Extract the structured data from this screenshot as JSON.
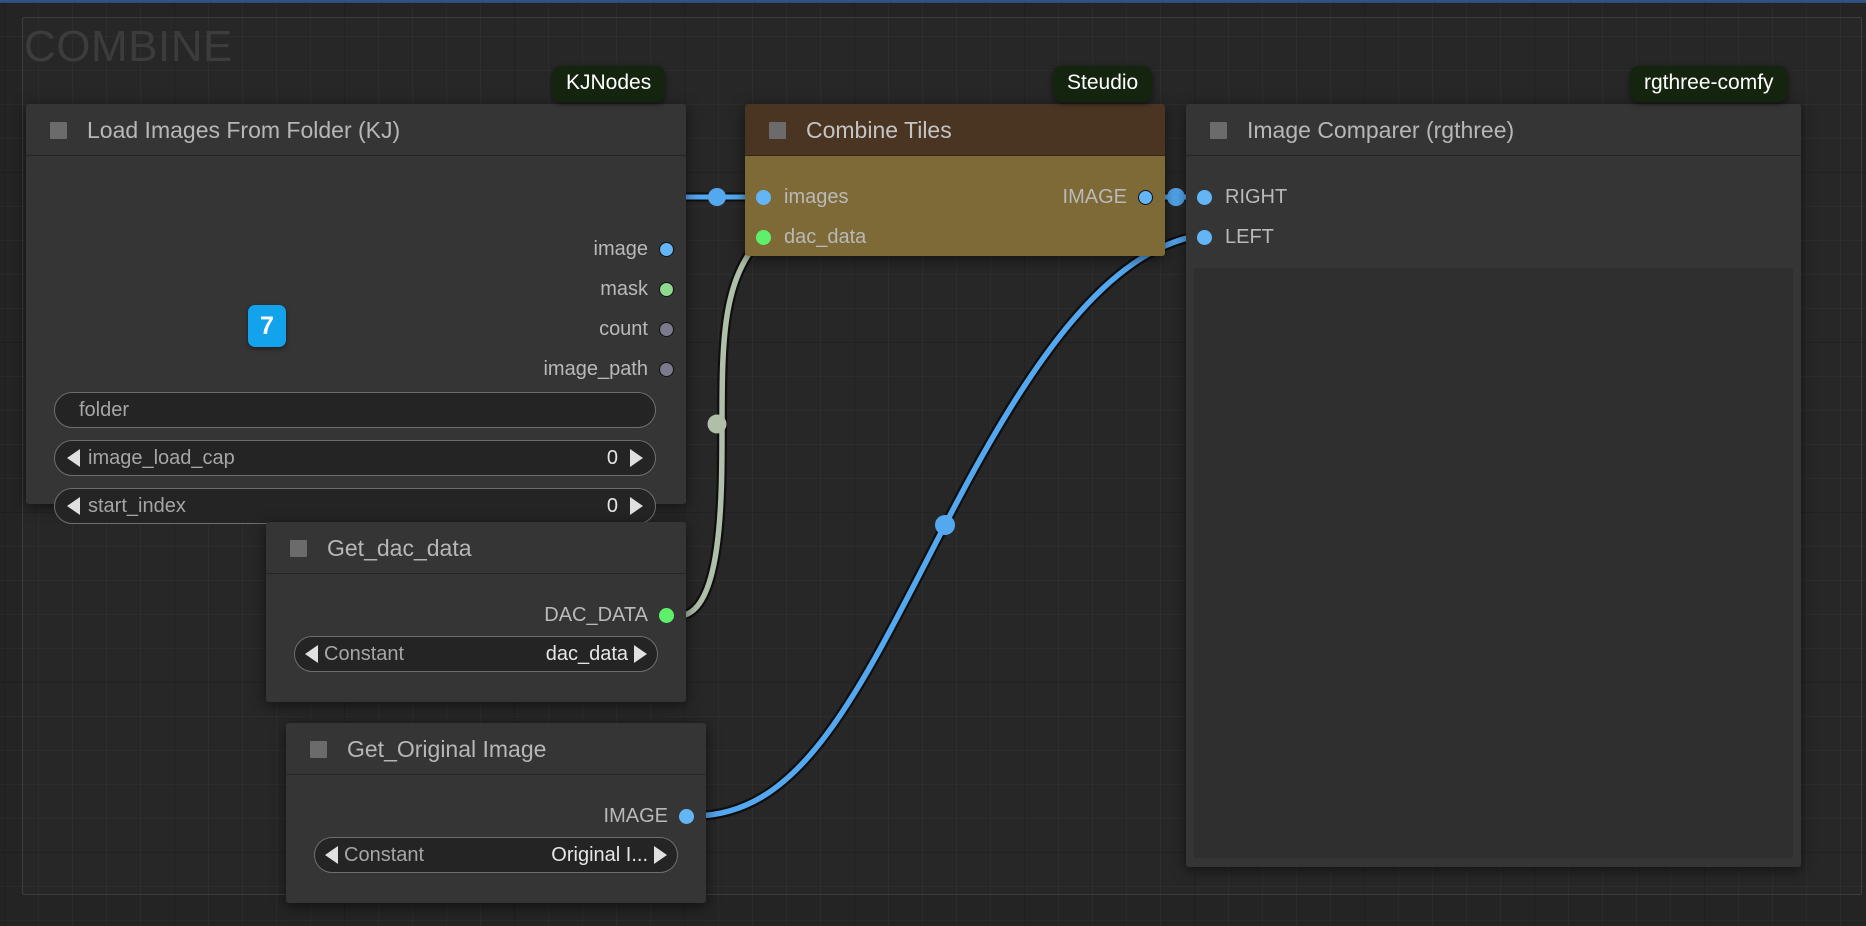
{
  "canvas": {
    "background": "#242424",
    "grid_minor": "#2b2b2b",
    "grid_major": "#1d1d1d"
  },
  "group": {
    "title": "COMBINE",
    "title_color": "#3c3c3c"
  },
  "colors": {
    "slot_image": "#64b5f6",
    "slot_mask": "#8fd88f",
    "slot_generic": "#7a7a8c",
    "slot_dac_data": "#5ef06a",
    "link_image": "#54a8f0",
    "link_dac_data": "#b0bfa9",
    "node_dark_header": "#353535",
    "node_dark_body": "#353535",
    "node_brown_header": "#4a3522",
    "node_brown_body": "#7e6a36",
    "badge_package": "#15240f",
    "badge_number": "#12a3ec"
  },
  "badges": [
    {
      "label": "KJNodes",
      "type": "package"
    },
    {
      "label": "Steudio",
      "type": "package"
    },
    {
      "label": "rgthree-comfy",
      "type": "package"
    },
    {
      "label": "7",
      "type": "number"
    }
  ],
  "nodes": [
    {
      "id": "load-images-from-folder",
      "title": "Load Images From Folder (KJ)",
      "package": "KJNodes",
      "theme": "dark",
      "outputs": [
        {
          "label": "image",
          "color": "#64b5f6"
        },
        {
          "label": "mask",
          "color": "#8fd88f"
        },
        {
          "label": "count",
          "color": "#7a7a8c"
        },
        {
          "label": "image_path",
          "color": "#7a7a8c"
        }
      ],
      "inputs": [],
      "widgets": [
        {
          "kind": "text",
          "name": "folder",
          "value": ""
        },
        {
          "kind": "number",
          "name": "image_load_cap",
          "value": "0"
        },
        {
          "kind": "number",
          "name": "start_index",
          "value": "0"
        }
      ]
    },
    {
      "id": "combine-tiles",
      "title": "Combine Tiles",
      "package": "Steudio",
      "theme": "brown",
      "inputs": [
        {
          "label": "images",
          "color": "#64b5f6"
        },
        {
          "label": "dac_data",
          "color": "#5ef06a"
        }
      ],
      "outputs": [
        {
          "label": "IMAGE",
          "color": "#64b5f6"
        }
      ],
      "widgets": []
    },
    {
      "id": "image-comparer-rgthree",
      "title": "Image Comparer (rgthree)",
      "package": "rgthree-comfy",
      "theme": "dark",
      "inputs": [
        {
          "label": "RIGHT",
          "color": "#64b5f6"
        },
        {
          "label": "LEFT",
          "color": "#64b5f6"
        }
      ],
      "outputs": [],
      "widgets": []
    },
    {
      "id": "get-dac-data",
      "title": "Get_dac_data",
      "theme": "dark",
      "inputs": [],
      "outputs": [
        {
          "label": "DAC_DATA",
          "color": "#5ef06a"
        }
      ],
      "widgets": [
        {
          "kind": "combo",
          "name": "Constant",
          "value": "dac_data"
        }
      ]
    },
    {
      "id": "get-original-image",
      "title": "Get_Original Image",
      "theme": "dark",
      "inputs": [],
      "outputs": [
        {
          "label": "IMAGE",
          "color": "#64b5f6"
        }
      ],
      "widgets": [
        {
          "kind": "combo",
          "name": "Constant",
          "value": "Original I..."
        }
      ]
    }
  ],
  "links": [
    {
      "from": "load-images-from-folder.image",
      "to": "combine-tiles.images",
      "color": "#54a8f0"
    },
    {
      "from": "get-dac-data.DAC_DATA",
      "to": "combine-tiles.dac_data",
      "color": "#b0bfa9"
    },
    {
      "from": "combine-tiles.IMAGE",
      "to": "image-comparer-rgthree.RIGHT",
      "color": "#54a8f0"
    },
    {
      "from": "get-original-image.IMAGE",
      "to": "image-comparer-rgthree.LEFT",
      "color": "#54a8f0"
    }
  ]
}
